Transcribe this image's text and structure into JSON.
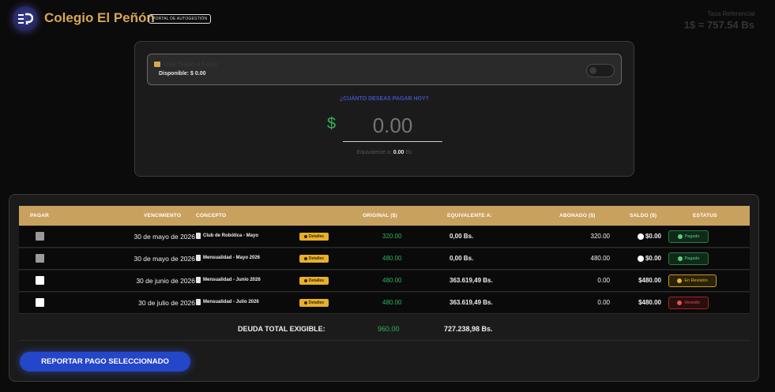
{
  "header": {
    "brand": "Colegio El Peñón",
    "portal_badge": "PORTAL DE AUTOGESTIÓN",
    "rate_label": "Tasa Referencial",
    "rate_value": "1$ = 757.54 Bs"
  },
  "payment": {
    "wallet_title": "Usar Saldo a Favor",
    "wallet_available": "Disponible: $ 0.00",
    "question": "¿CUÁNTO DESEAS PAGAR HOY?",
    "currency_symbol": "$",
    "amount_placeholder": "0.00",
    "equiv_prefix": "Equivalente a:",
    "equiv_value": "0.00",
    "equiv_unit": "Bs"
  },
  "table": {
    "headers": {
      "pay": "PAGAR",
      "due": "VENCIMIENTO",
      "concept": "CONCEPTO",
      "original": "ORIGINAL ($)",
      "equivalent": "EQUIVALENTE A:",
      "paid": "ABONADO ($)",
      "balance": "SALDO ($)",
      "status": "ESTATUS"
    },
    "details_label": "Detalles",
    "rows": [
      {
        "due": "30 de mayo de 2026",
        "concept": "Club de Robótica - Mayo",
        "original": "320.00",
        "equivalent": "0,00 Bs.",
        "paid": "320.00",
        "balance": "$0.00",
        "status": "Pagado",
        "status_kind": "paid",
        "checkbox": "disabled"
      },
      {
        "due": "30 de mayo de 2026",
        "concept": "Mensualidad - Mayo 2026",
        "original": "480.00",
        "equivalent": "0,00 Bs.",
        "paid": "480.00",
        "balance": "$0.00",
        "status": "Pagado",
        "status_kind": "paid",
        "checkbox": "disabled"
      },
      {
        "due": "30 de junio de 2026",
        "concept": "Mensualidad - Junio 2026",
        "original": "480.00",
        "equivalent": "363.619,49 Bs.",
        "paid": "0.00",
        "balance": "$480.00",
        "status": "En Revisión",
        "status_kind": "review",
        "checkbox": "empty"
      },
      {
        "due": "30 de julio de 2026",
        "concept": "Mensualidad - Julio 2026",
        "original": "480.00",
        "equivalent": "363.619,49 Bs.",
        "paid": "0.00",
        "balance": "$480.00",
        "status": "Vencido",
        "status_kind": "overdue",
        "checkbox": "empty"
      }
    ],
    "total_label": "DEUDA TOTAL EXIGIBLE:",
    "total_original": "960.00",
    "total_equivalent": "727.238,98 Bs."
  },
  "actions": {
    "report_label": "REPORTAR PAGO SELECCIONADO"
  }
}
